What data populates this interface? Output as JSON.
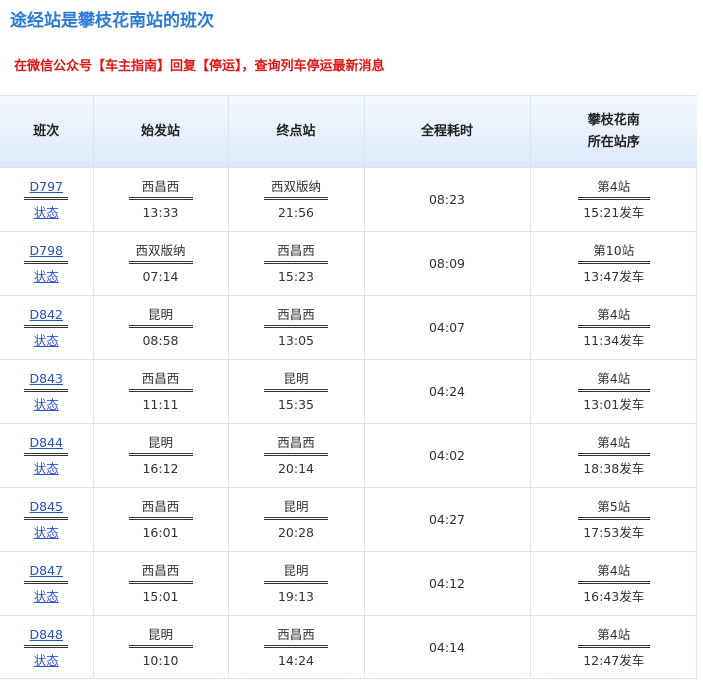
{
  "page": {
    "title": "途经站是攀枝花南站的班次",
    "notice": "在微信公众号【车主指南】回复【停运】，查询列车停运最新消息"
  },
  "table": {
    "headers": [
      "班次",
      "始发站",
      "终点站",
      "全程耗时",
      "攀枝花南",
      "所在站序"
    ],
    "status_label": "状态",
    "rows": [
      {
        "code": "D797",
        "origin": "西昌西",
        "depart": "13:33",
        "dest": "西双版纳",
        "arrive": "21:56",
        "duration": "08:23",
        "order": "第4站",
        "local_time": "15:21发车"
      },
      {
        "code": "D798",
        "origin": "西双版纳",
        "depart": "07:14",
        "dest": "西昌西",
        "arrive": "15:23",
        "duration": "08:09",
        "order": "第10站",
        "local_time": "13:47发车"
      },
      {
        "code": "D842",
        "origin": "昆明",
        "depart": "08:58",
        "dest": "西昌西",
        "arrive": "13:05",
        "duration": "04:07",
        "order": "第4站",
        "local_time": "11:34发车"
      },
      {
        "code": "D843",
        "origin": "西昌西",
        "depart": "11:11",
        "dest": "昆明",
        "arrive": "15:35",
        "duration": "04:24",
        "order": "第4站",
        "local_time": "13:01发车"
      },
      {
        "code": "D844",
        "origin": "昆明",
        "depart": "16:12",
        "dest": "西昌西",
        "arrive": "20:14",
        "duration": "04:02",
        "order": "第4站",
        "local_time": "18:38发车"
      },
      {
        "code": "D845",
        "origin": "西昌西",
        "depart": "16:01",
        "dest": "昆明",
        "arrive": "20:28",
        "duration": "04:27",
        "order": "第5站",
        "local_time": "17:53发车"
      },
      {
        "code": "D847",
        "origin": "西昌西",
        "depart": "15:01",
        "dest": "昆明",
        "arrive": "19:13",
        "duration": "04:12",
        "order": "第4站",
        "local_time": "16:43发车"
      },
      {
        "code": "D848",
        "origin": "昆明",
        "depart": "10:10",
        "dest": "西昌西",
        "arrive": "14:24",
        "duration": "04:14",
        "order": "第4站",
        "local_time": "12:47发车"
      }
    ]
  }
}
